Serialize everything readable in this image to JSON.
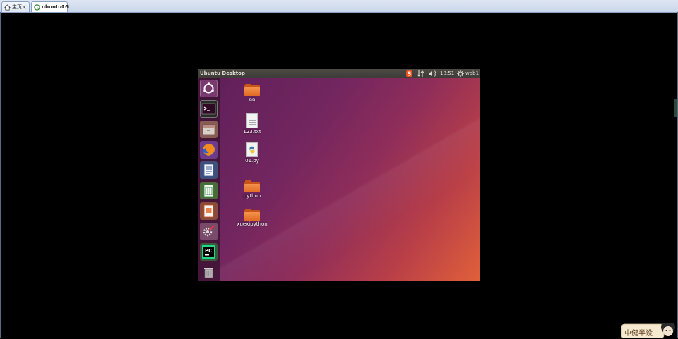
{
  "host": {
    "tabs": [
      {
        "label": "主页",
        "icon": "home-icon"
      },
      {
        "label": "ubuntu16",
        "icon": "vm-icon"
      }
    ],
    "close_glyph": "✕"
  },
  "vm": {
    "window_title": "Ubuntu Desktop",
    "indicators": {
      "time": "18:51",
      "user": "wqb1"
    },
    "launcher": [
      "ubuntu-dash-icon",
      "terminal-icon",
      "files-icon",
      "firefox-icon",
      "writer-icon",
      "calc-icon",
      "impress-icon",
      "system-settings-icon",
      "pycharm-icon",
      "trash-icon"
    ],
    "desktop_icons": [
      {
        "label": "aa",
        "type": "folder"
      },
      {
        "label": "123.txt",
        "type": "text-file"
      },
      {
        "label": "01.py",
        "type": "python-file"
      },
      {
        "label": "python",
        "type": "folder"
      },
      {
        "label": "xuexipython",
        "type": "folder"
      }
    ]
  },
  "watermark": {
    "text": "中健半设"
  },
  "colors": {
    "topbar": "#3c3b37",
    "desktop_start": "#5e1f5a",
    "desktop_end": "#e0603a",
    "folder": "#e26a23"
  }
}
